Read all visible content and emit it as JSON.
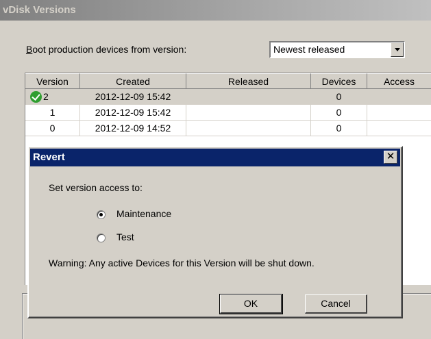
{
  "window": {
    "title": "vDisk Versions"
  },
  "boot": {
    "label_prefix": "B",
    "label_rest": "oot production devices from version:",
    "selected": "Newest released"
  },
  "grid": {
    "columns": [
      "Version",
      "Created",
      "Released",
      "Devices",
      "Access"
    ],
    "rows": [
      {
        "version": "2",
        "created": "2012-12-09 15:42",
        "released": "",
        "devices": "0",
        "access": ""
      },
      {
        "version": "1",
        "created": "2012-12-09 15:42",
        "released": "",
        "devices": "0",
        "access": ""
      },
      {
        "version": "0",
        "created": "2012-12-09 14:52",
        "released": "",
        "devices": "0",
        "access": ""
      }
    ]
  },
  "dialog": {
    "title": "Revert",
    "close_glyph": "✕",
    "prompt": "Set version access to:",
    "options": [
      "Maintenance",
      "Test"
    ],
    "selected_option": "Maintenance",
    "warning": "Warning: Any active Devices for this Version will be shut down.",
    "ok_label": "OK",
    "cancel_label": "Cancel"
  }
}
